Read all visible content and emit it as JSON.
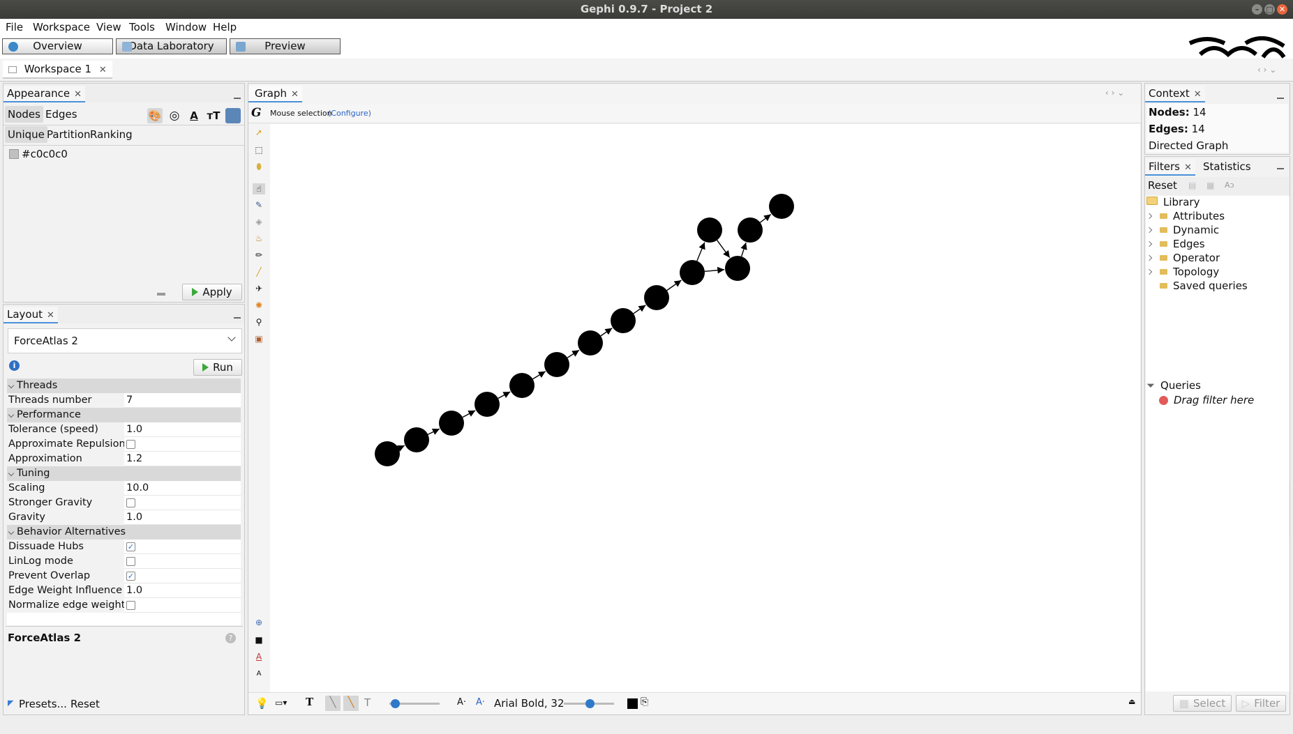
{
  "window": {
    "title": "Gephi 0.9.7 - Project 2"
  },
  "menu": [
    "File",
    "Workspace",
    "View",
    "Tools",
    "Window",
    "Help"
  ],
  "modes": {
    "overview": "Overview",
    "data_laboratory": "Data Laboratory",
    "preview": "Preview"
  },
  "workspace_tab": "Workspace 1",
  "appearance": {
    "title": "Appearance",
    "tabs": {
      "nodes": "Nodes",
      "edges": "Edges"
    },
    "subtabs": {
      "unique": "Unique",
      "partition": "Partition",
      "ranking": "Ranking"
    },
    "color_value": "#c0c0c0",
    "apply_label": "Apply"
  },
  "layout": {
    "title": "Layout",
    "algorithm": "ForceAtlas 2",
    "run_label": "Run",
    "sections": {
      "threads": "Threads",
      "performance": "Performance",
      "tuning": "Tuning",
      "behavior": "Behavior Alternatives"
    },
    "props": {
      "threads_number": {
        "label": "Threads number",
        "value": "7"
      },
      "tolerance": {
        "label": "Tolerance (speed)",
        "value": "1.0"
      },
      "approx_repulsion": {
        "label": "Approximate Repulsion",
        "checked": false
      },
      "approximation": {
        "label": "Approximation",
        "value": "1.2"
      },
      "scaling": {
        "label": "Scaling",
        "value": "10.0"
      },
      "stronger_gravity": {
        "label": "Stronger Gravity",
        "checked": false
      },
      "gravity": {
        "label": "Gravity",
        "value": "1.0"
      },
      "dissuade_hubs": {
        "label": "Dissuade Hubs",
        "checked": true
      },
      "linlog": {
        "label": "LinLog mode",
        "checked": false
      },
      "prevent_overlap": {
        "label": "Prevent Overlap",
        "checked": true
      },
      "edge_weight": {
        "label": "Edge Weight Influence",
        "value": "1.0"
      },
      "normalize": {
        "label": "Normalize edge weights",
        "checked": false
      }
    },
    "description_title": "ForceAtlas 2",
    "presets_label": "Presets...",
    "reset_label": "Reset"
  },
  "graph": {
    "title": "Graph",
    "mouse_selection": "Mouse selection",
    "configure": "(Configure)",
    "font_label": "Arial Bold, 32",
    "node_color": "#000000",
    "nodes": [
      {
        "id": 0
      },
      {
        "id": 1
      },
      {
        "id": 2
      },
      {
        "id": 3
      },
      {
        "id": 4
      },
      {
        "id": 5
      },
      {
        "id": 6
      },
      {
        "id": 7
      },
      {
        "id": 8
      },
      {
        "id": 9
      },
      {
        "id": 10
      },
      {
        "id": 11
      },
      {
        "id": 12
      },
      {
        "id": 13
      }
    ],
    "edges": [
      [
        0,
        1
      ],
      [
        1,
        2
      ],
      [
        2,
        3
      ],
      [
        3,
        4
      ],
      [
        4,
        5
      ],
      [
        5,
        6
      ],
      [
        6,
        7
      ],
      [
        7,
        8
      ],
      [
        8,
        9
      ],
      [
        9,
        10
      ],
      [
        10,
        11
      ],
      [
        11,
        12
      ],
      [
        12,
        13
      ],
      [
        9,
        11
      ]
    ]
  },
  "context": {
    "title": "Context",
    "nodes_label": "Nodes:",
    "nodes_value": "14",
    "edges_label": "Edges:",
    "edges_value": "14",
    "graph_type": "Directed Graph"
  },
  "filters": {
    "title": "Filters",
    "statistics_tab": "Statistics",
    "reset_label": "Reset",
    "library": "Library",
    "items": [
      "Attributes",
      "Dynamic",
      "Edges",
      "Operator",
      "Topology",
      "Saved queries"
    ],
    "queries": "Queries",
    "drag_hint": "Drag filter here",
    "select_label": "Select",
    "filter_label": "Filter"
  }
}
